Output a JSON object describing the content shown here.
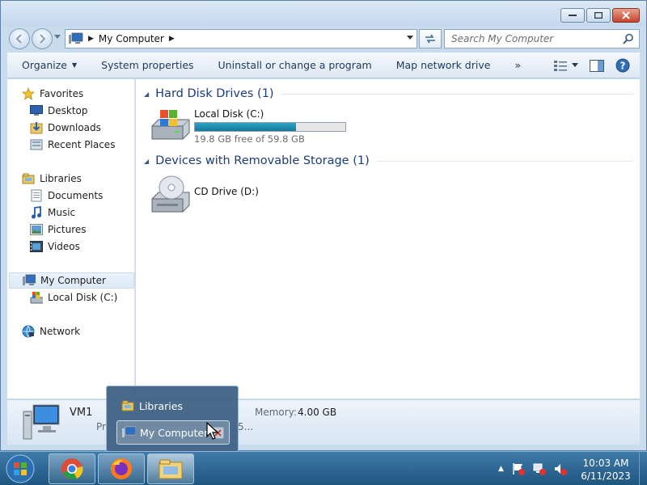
{
  "window": {
    "title": ""
  },
  "address": {
    "segments": [
      "My Computer"
    ]
  },
  "search": {
    "placeholder": "Search My Computer"
  },
  "commands": {
    "organize": "Organize",
    "system_properties": "System properties",
    "uninstall": "Uninstall or change a program",
    "map_drive": "Map network drive",
    "more": "»"
  },
  "nav": {
    "favorites": "Favorites",
    "desktop": "Desktop",
    "downloads": "Downloads",
    "recent_places": "Recent Places",
    "libraries": "Libraries",
    "documents": "Documents",
    "music": "Music",
    "pictures": "Pictures",
    "videos": "Videos",
    "my_computer": "My Computer",
    "local_disk": "Local Disk (C:)",
    "network": "Network"
  },
  "groups": [
    {
      "title": "Hard Disk Drives (1)"
    },
    {
      "title": "Devices with Removable Storage (1)"
    }
  ],
  "drives": {
    "c": {
      "name": "Local Disk (C:)",
      "free_text": "19.8 GB free of 59.8 GB",
      "used_fraction": 0.67
    },
    "d": {
      "name": "CD Drive (D:)"
    }
  },
  "details": {
    "name": "VM1",
    "memory_label": "Memory:",
    "memory_value": "4.00 GB",
    "processor_label": "Pr",
    "trail": "5..."
  },
  "popup": {
    "items": [
      "Libraries",
      "My Computer"
    ]
  },
  "clock": {
    "time": "10:03 AM",
    "date": "6/11/2023"
  },
  "colors": {
    "accent": "#1e3c78",
    "taskbar": "#2a6590",
    "capacity": "#1e8db1"
  }
}
